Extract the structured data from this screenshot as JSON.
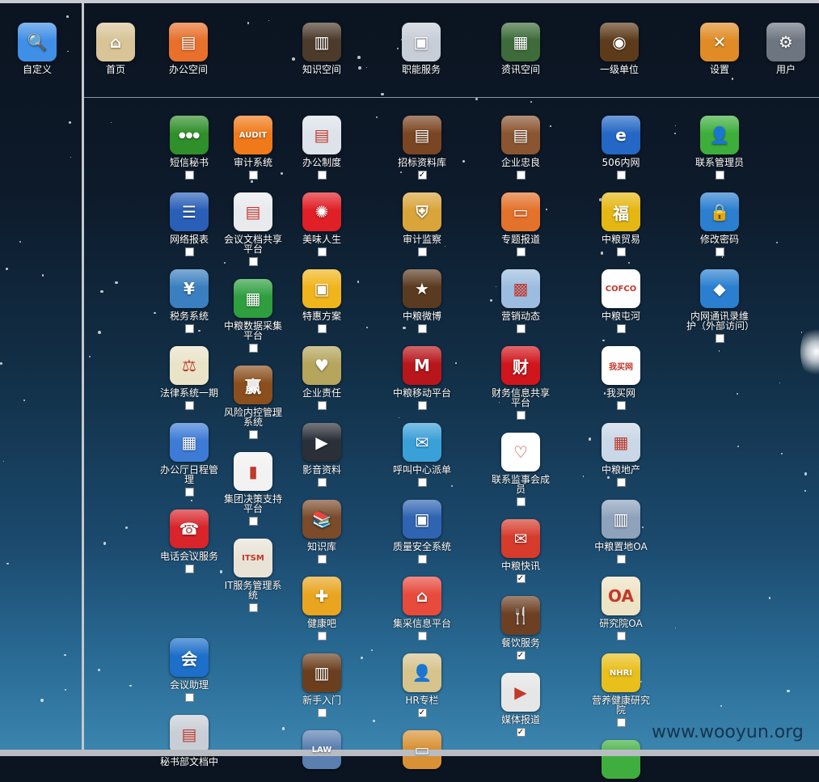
{
  "left_panel": {
    "label": "自定义",
    "icon": "customize-icon"
  },
  "top_nav": [
    {
      "label": "首页",
      "icon": "home-icon"
    },
    {
      "label": "办公空间",
      "icon": "drawer-icon"
    },
    {
      "label": "知识空间",
      "icon": "books-icon"
    },
    {
      "label": "职能服务",
      "icon": "screen-icon"
    },
    {
      "label": "资讯空间",
      "icon": "newspaper-icon"
    },
    {
      "label": "一级单位",
      "icon": "globe-icon"
    },
    {
      "label": "设置",
      "icon": "tools-icon"
    },
    {
      "label": "用户",
      "icon": "gear-icon"
    }
  ],
  "columns": [
    [
      {
        "label": "短信秘书",
        "checked": false,
        "icon": "sms-icon",
        "color": "#2f8f2a",
        "glyph": "●●●"
      },
      {
        "label": "网络报表",
        "checked": false,
        "icon": "notebook-icon",
        "color": "#2a5fb8",
        "glyph": "☰"
      },
      {
        "label": "税务系统",
        "checked": false,
        "icon": "tax-icon",
        "color": "#3a7fc0",
        "glyph": "¥"
      },
      {
        "label": "法律系统一期",
        "checked": false,
        "icon": "law-icon",
        "color": "#e9e3c8",
        "glyph": "⚖"
      },
      {
        "label": "办公厅日程管理",
        "checked": false,
        "icon": "calendar-icon",
        "color": "#3d7bd6",
        "glyph": "▦"
      },
      {
        "label": "电话会议服务",
        "checked": false,
        "icon": "phone-icon",
        "color": "#d8242a",
        "glyph": "☎"
      },
      {
        "label": "",
        "checked": null,
        "icon": "",
        "color": "",
        "glyph": ""
      },
      {
        "label": "会议助理",
        "checked": false,
        "icon": "meeting-icon",
        "color": "#1d6fc9",
        "glyph": "会"
      },
      {
        "label": "秘书部文档中",
        "checked": null,
        "icon": "documents-icon",
        "color": "#c9ced6",
        "glyph": "▤"
      }
    ],
    [
      {
        "label": "审计系统",
        "checked": false,
        "icon": "audit-icon",
        "color": "#f07a1a",
        "glyph": "AUDIT"
      },
      {
        "label": "会议文档共享平台",
        "checked": false,
        "icon": "docs-share-icon",
        "color": "#e8eaee",
        "glyph": "▤"
      },
      {
        "label": "中粮数据采集平台",
        "checked": false,
        "icon": "spreadsheet-icon",
        "color": "#2e9e3f",
        "glyph": "▦"
      },
      {
        "label": "风险内控管理系统",
        "checked": false,
        "icon": "risk-icon",
        "color": "#8a4f1d",
        "glyph": "赢"
      },
      {
        "label": "集团决策支持平台",
        "checked": false,
        "icon": "bar-chart-icon",
        "color": "#f2f2f2",
        "glyph": "▮"
      },
      {
        "label": "IT服务管理系统",
        "checked": false,
        "icon": "itsm-icon",
        "color": "#e9e3d7",
        "glyph": "ITSM"
      }
    ],
    [
      {
        "label": "办公制度",
        "checked": false,
        "icon": "rules-icon",
        "color": "#dde3ea",
        "glyph": "▤"
      },
      {
        "label": "美味人生",
        "checked": false,
        "icon": "gift-icon",
        "color": "#e01f26",
        "glyph": "✺"
      },
      {
        "label": "特惠方案",
        "checked": false,
        "icon": "offer-icon",
        "color": "#f1b51c",
        "glyph": "▣"
      },
      {
        "label": "企业责任",
        "checked": false,
        "icon": "heart-icon",
        "color": "#b5a55d",
        "glyph": "♥"
      },
      {
        "label": "影音资料",
        "checked": false,
        "icon": "play-icon",
        "color": "#2b2f38",
        "glyph": "▶"
      },
      {
        "label": "知识库",
        "checked": false,
        "icon": "bookshelf-icon",
        "color": "#7b4b2a",
        "glyph": "📚"
      },
      {
        "label": "健康吧",
        "checked": false,
        "icon": "medkit-icon",
        "color": "#e9a520",
        "glyph": "✚"
      },
      {
        "label": "新手入门",
        "checked": false,
        "icon": "book-icon",
        "color": "#6b3f1e",
        "glyph": "▥"
      },
      {
        "label": "",
        "checked": null,
        "icon": "law-book-icon",
        "color": "#5a7fb0",
        "glyph": "LAW"
      }
    ],
    [
      {
        "label": "招标资料库",
        "checked": true,
        "icon": "cabinet-icon",
        "color": "#7a4522",
        "glyph": "▤"
      },
      {
        "label": "审计监察",
        "checked": false,
        "icon": "shield-icon",
        "color": "#d9a53a",
        "glyph": "⛨"
      },
      {
        "label": "中粮微博",
        "checked": false,
        "icon": "weibo-icon",
        "color": "#5a3a20",
        "glyph": "★"
      },
      {
        "label": "中粮移动平台",
        "checked": false,
        "icon": "mobile-icon",
        "color": "#b8161b",
        "glyph": "M"
      },
      {
        "label": "呼叫中心派单",
        "checked": false,
        "icon": "dispatch-icon",
        "color": "#3aa0d8",
        "glyph": "✉"
      },
      {
        "label": "质量安全系统",
        "checked": false,
        "icon": "quality-icon",
        "color": "#2f64b2",
        "glyph": "▣"
      },
      {
        "label": "集采信息平台",
        "checked": false,
        "icon": "store-icon",
        "color": "#e84a3c",
        "glyph": "⌂"
      },
      {
        "label": "HR专栏",
        "checked": true,
        "icon": "hr-icon",
        "color": "#d7c38c",
        "glyph": "👤"
      },
      {
        "label": "",
        "checked": null,
        "icon": "folder-icon",
        "color": "#d89235",
        "glyph": "▭"
      }
    ],
    [
      {
        "label": "企业忠良",
        "checked": false,
        "icon": "shelf-icon",
        "color": "#8a5530",
        "glyph": "▤"
      },
      {
        "label": "专题报道",
        "checked": false,
        "icon": "folders-icon",
        "color": "#e4722b",
        "glyph": "▭"
      },
      {
        "label": "营销动态",
        "checked": false,
        "icon": "photo-icon",
        "color": "#9dbde0",
        "glyph": "▩"
      },
      {
        "label": "财务信息共享平台",
        "checked": false,
        "icon": "finance-icon",
        "color": "#d0161c",
        "glyph": "财"
      },
      {
        "label": "联系监事会成员",
        "checked": false,
        "icon": "handshake-icon",
        "color": "#ffffff",
        "glyph": "♡"
      },
      {
        "label": "中粮快讯",
        "checked": true,
        "icon": "news-flash-icon",
        "color": "#d63b2c",
        "glyph": "✉"
      },
      {
        "label": "餐饮服务",
        "checked": true,
        "icon": "dining-icon",
        "color": "#6d4024",
        "glyph": "🍴"
      },
      {
        "label": "媒体报道",
        "checked": true,
        "icon": "media-icon",
        "color": "#e6e6e6",
        "glyph": "▶"
      }
    ],
    [
      {
        "label": "506内网",
        "checked": false,
        "icon": "ie-icon",
        "color": "#2467c4",
        "glyph": "e"
      },
      {
        "label": "中粮贸易",
        "checked": false,
        "icon": "trade-icon",
        "color": "#e5b713",
        "glyph": "福"
      },
      {
        "label": "中粮屯河",
        "checked": false,
        "icon": "tunhe-icon",
        "color": "#ffffff",
        "glyph": "COFCO"
      },
      {
        "label": "我买网",
        "checked": false,
        "icon": "womai-icon",
        "color": "#ffffff",
        "glyph": "我买网"
      },
      {
        "label": "中粮地产",
        "checked": false,
        "icon": "real-estate-icon",
        "color": "#c9d7e6",
        "glyph": "▦"
      },
      {
        "label": "中粮置地OA",
        "checked": false,
        "icon": "building-icon",
        "color": "#8fa2bc",
        "glyph": "▥"
      },
      {
        "label": "研究院OA",
        "checked": false,
        "icon": "institute-icon",
        "color": "#eee3c4",
        "glyph": "OA"
      },
      {
        "label": "营养健康研究院",
        "checked": false,
        "icon": "nhri-icon",
        "color": "#e9bf1b",
        "glyph": "NHRI"
      },
      {
        "label": "",
        "checked": null,
        "icon": "green-icon",
        "color": "#3fae3f",
        "glyph": ""
      }
    ],
    [
      {
        "label": "联系管理员",
        "checked": false,
        "icon": "contact-admin-icon",
        "color": "#3dae3c",
        "glyph": "👤"
      },
      {
        "label": "修改密码",
        "checked": false,
        "icon": "lock-icon",
        "color": "#2b7fd0",
        "glyph": "🔒"
      },
      {
        "label": "内网通讯录维护（外部访问）",
        "checked": false,
        "icon": "cube-icon",
        "color": "#2a7fd0",
        "glyph": "◆"
      }
    ]
  ],
  "watermark": "www.wooyun.org"
}
